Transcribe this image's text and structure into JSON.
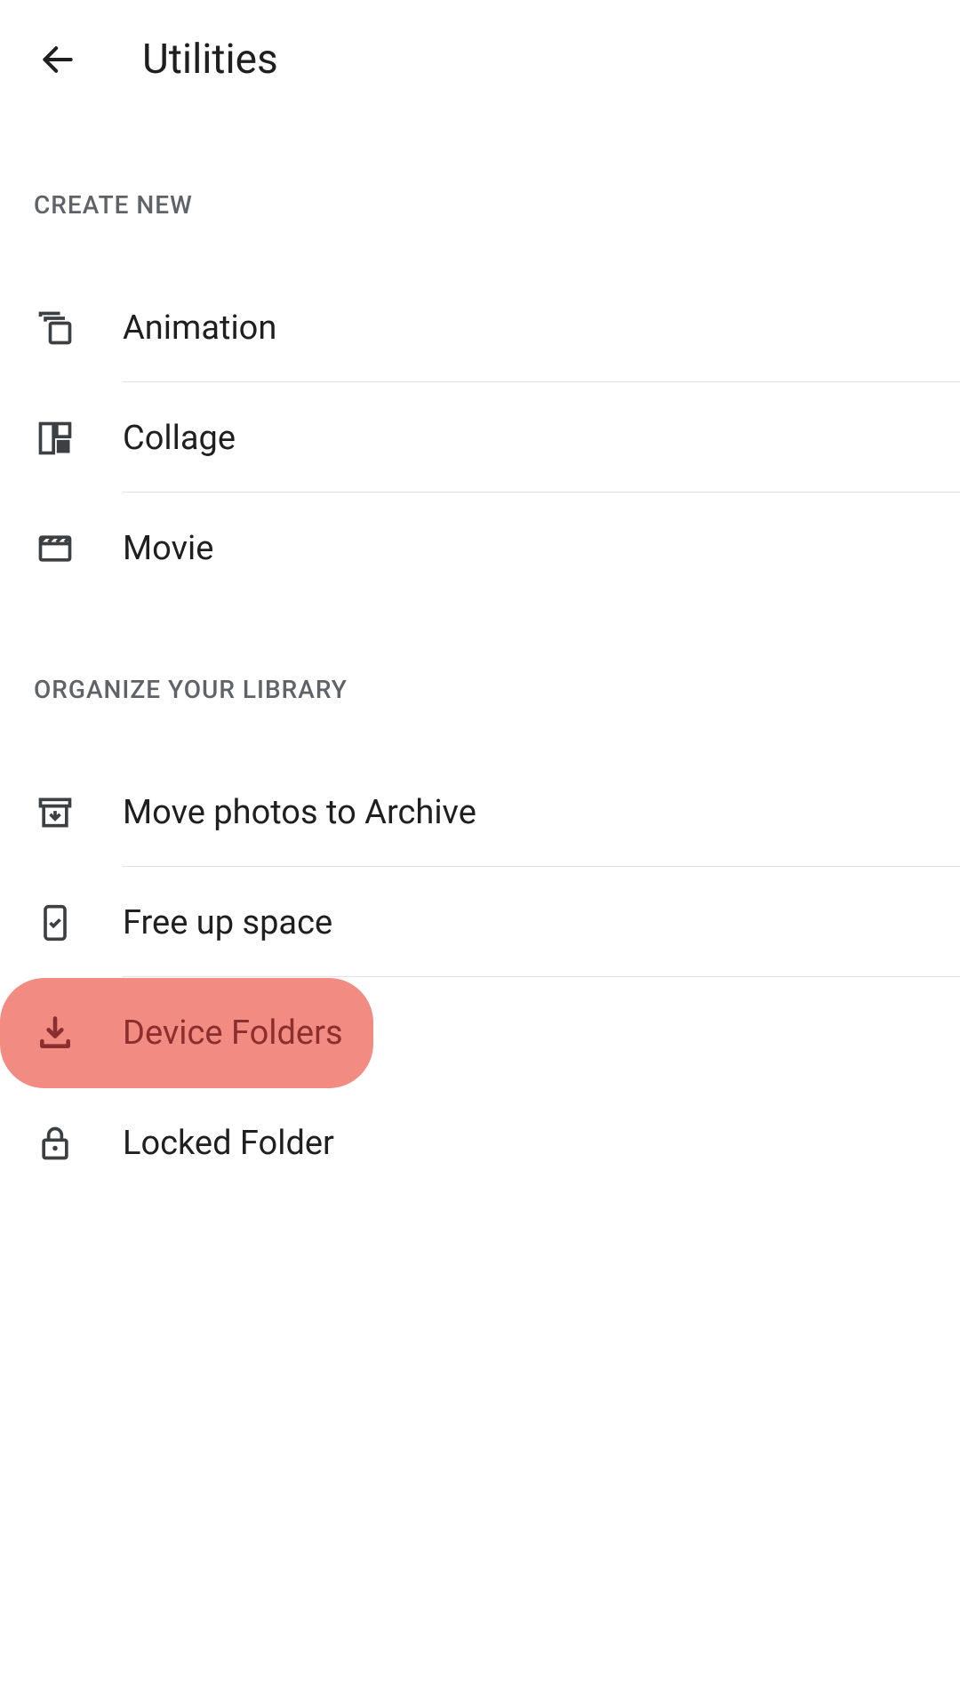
{
  "header": {
    "title": "Utilities"
  },
  "sections": [
    {
      "id": "create",
      "header": "CREATE NEW",
      "items": [
        {
          "id": "animation",
          "label": "Animation"
        },
        {
          "id": "collage",
          "label": "Collage"
        },
        {
          "id": "movie",
          "label": "Movie"
        }
      ]
    },
    {
      "id": "organize",
      "header": "ORGANIZE YOUR LIBRARY",
      "items": [
        {
          "id": "archive",
          "label": "Move photos to Archive"
        },
        {
          "id": "freeup",
          "label": "Free up space"
        },
        {
          "id": "device-folders",
          "label": "Device Folders",
          "highlighted": true
        },
        {
          "id": "locked-folder",
          "label": "Locked Folder"
        }
      ]
    }
  ]
}
